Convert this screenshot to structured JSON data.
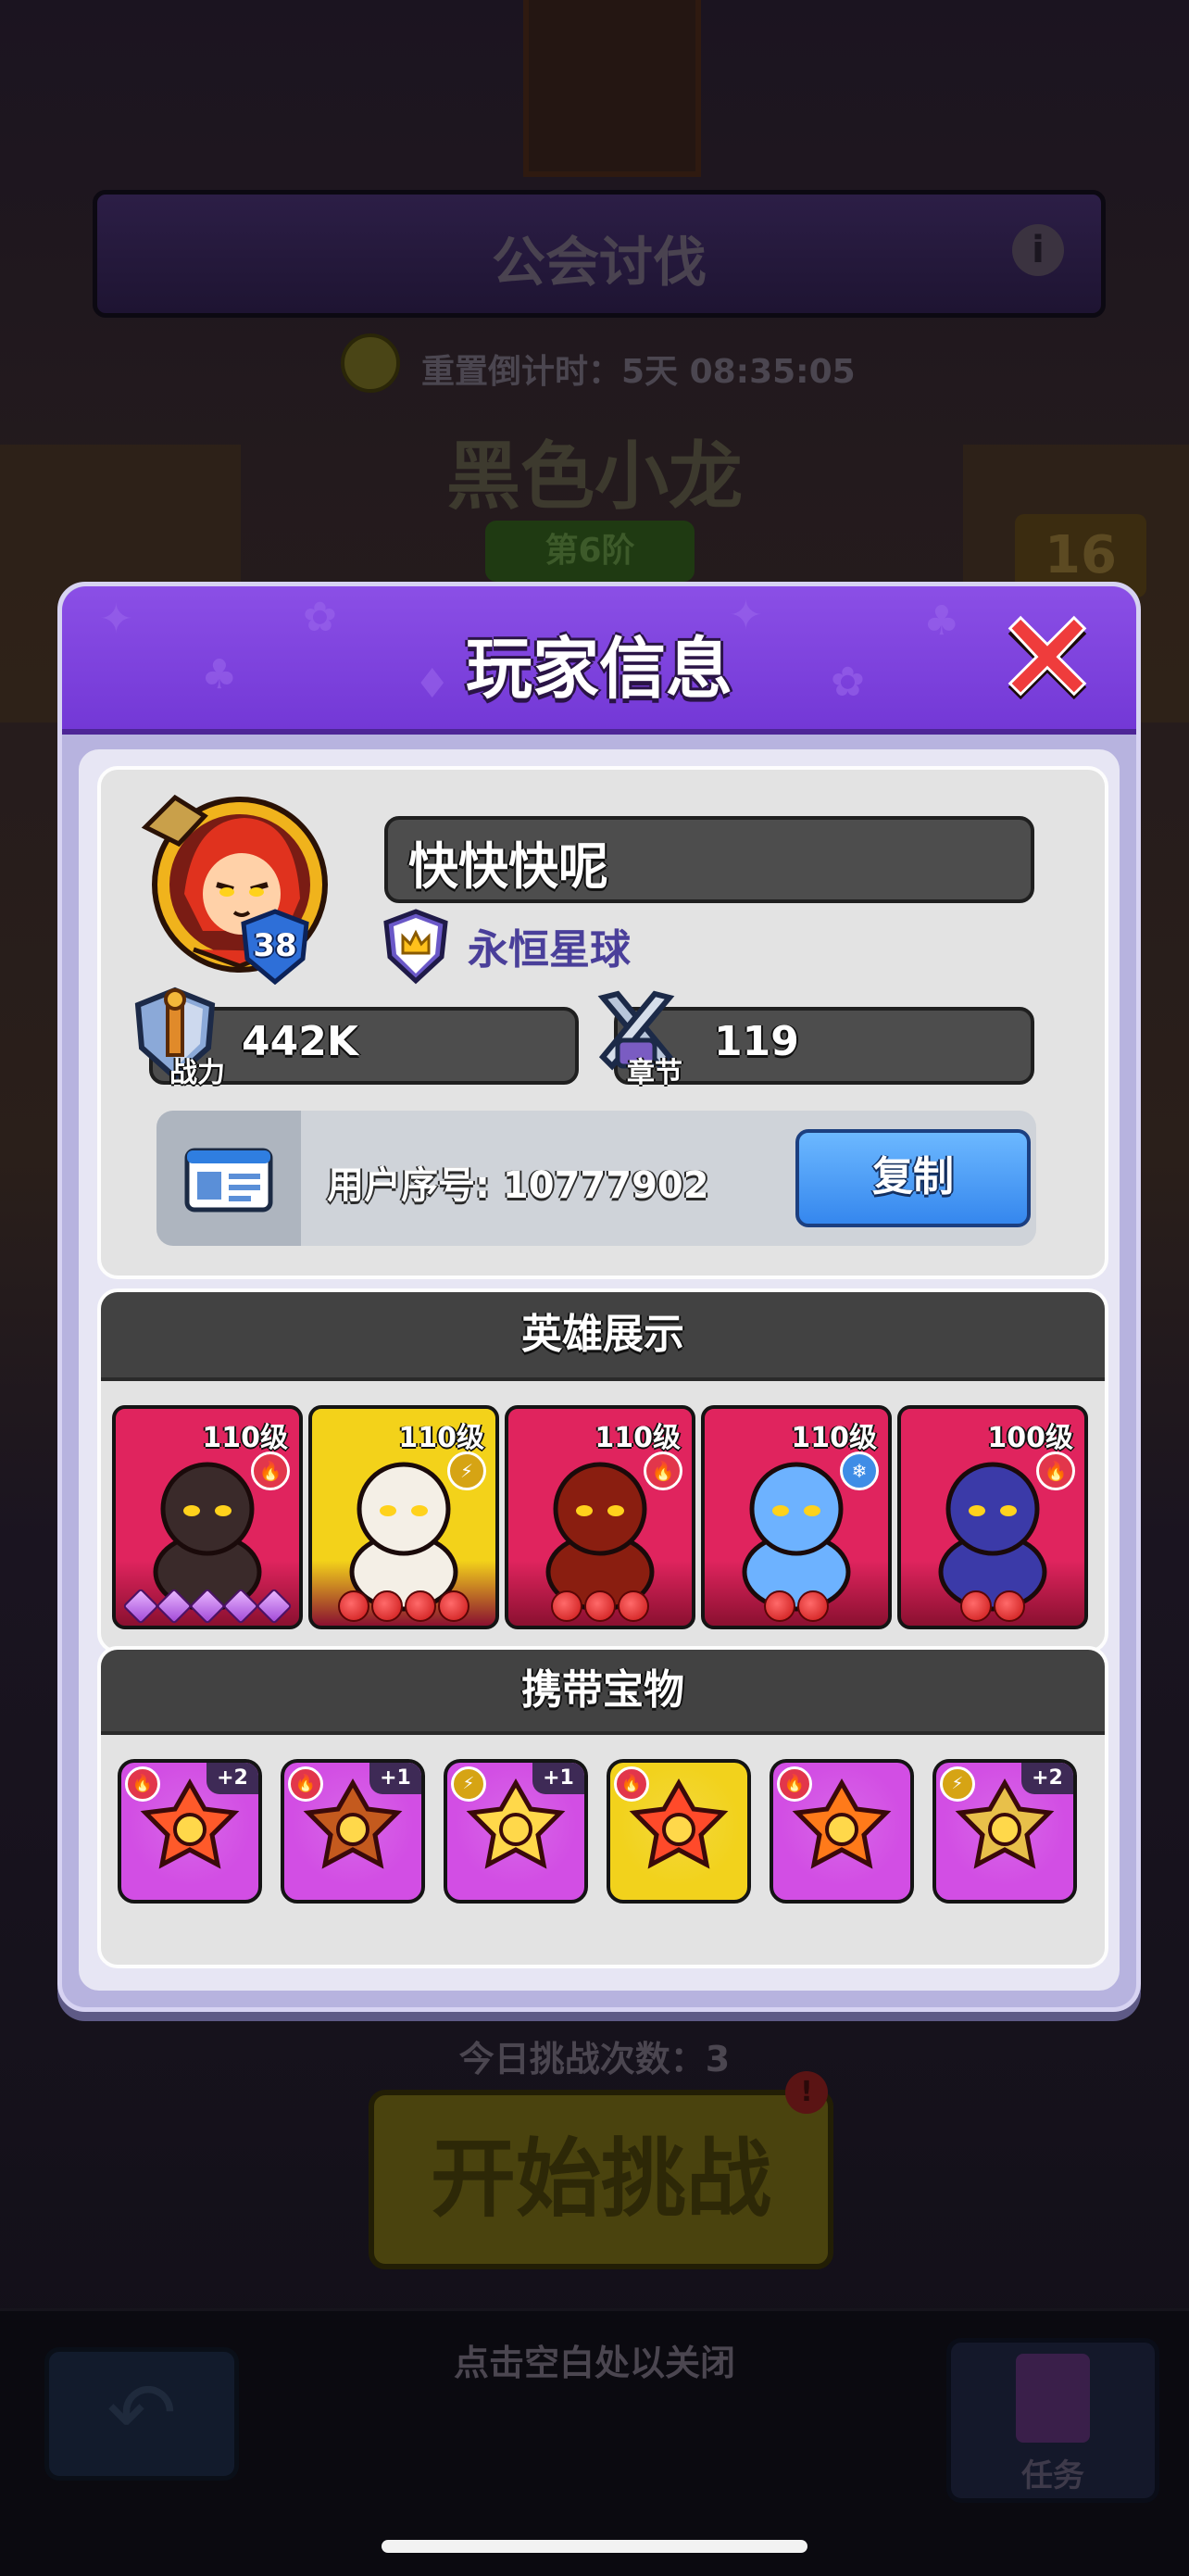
{
  "background": {
    "banner_title": "公会讨伐",
    "reset_timer": "重置倒计时：5天 08:35:05",
    "boss_name": "黑色小龙",
    "tier": "第6阶",
    "level_badge": "16",
    "challenges_today": "今日挑战次数：3",
    "start_button": "开始挑战",
    "alert_mark": "!",
    "close_hint": "点击空白处以关闭",
    "tasks_label": "任务"
  },
  "modal": {
    "title": "玩家信息",
    "player": {
      "name": "快快快呢",
      "level": "38",
      "guild": "永恒星球",
      "power_label": "战力",
      "power_value": "442K",
      "chapter_label": "章节",
      "chapter_value": "119",
      "uid_text": "用户序号: 10777902",
      "copy_button": "复制"
    },
    "heroes_title": "英雄展示",
    "heroes": [
      {
        "level": "110级",
        "element": "fire",
        "element_glyph": "🔥",
        "stars": 5,
        "star_type": "purple",
        "color": "#e0245e"
      },
      {
        "level": "110级",
        "element": "lightning",
        "element_glyph": "⚡",
        "stars": 4,
        "star_type": "red",
        "color": "#f3d21a"
      },
      {
        "level": "110级",
        "element": "fire",
        "element_glyph": "🔥",
        "stars": 3,
        "star_type": "red",
        "color": "#e0245e"
      },
      {
        "level": "110级",
        "element": "ice",
        "element_glyph": "❄",
        "stars": 2,
        "star_type": "red",
        "color": "#e0245e"
      },
      {
        "level": "100级",
        "element": "fire",
        "element_glyph": "🔥",
        "stars": 2,
        "star_type": "red",
        "color": "#e0245e"
      }
    ],
    "treasures_title": "携带宝物",
    "treasures": [
      {
        "element": "fire",
        "element_glyph": "🔥",
        "plus": "+2",
        "color": "#d24ee4",
        "icon": "sun-gear-icon"
      },
      {
        "element": "fire",
        "element_glyph": "🔥",
        "plus": "+1",
        "color": "#d24ee4",
        "icon": "monster-shield-icon"
      },
      {
        "element": "lightning",
        "element_glyph": "⚡",
        "plus": "+1",
        "color": "#d24ee4",
        "icon": "gold-shard-icon"
      },
      {
        "element": "fire",
        "element_glyph": "🔥",
        "plus": "",
        "color": "#f2d21c",
        "icon": "flame-phoenix-icon"
      },
      {
        "element": "fire",
        "element_glyph": "🔥",
        "plus": "",
        "color": "#d24ee4",
        "icon": "crossed-rings-icon"
      },
      {
        "element": "lightning",
        "element_glyph": "⚡",
        "plus": "+2",
        "color": "#d24ee4",
        "icon": "gold-tile-icon"
      }
    ]
  },
  "colors": {
    "fire": "#e2364b",
    "lightning": "#d6a414",
    "ice": "#3f8de6"
  }
}
